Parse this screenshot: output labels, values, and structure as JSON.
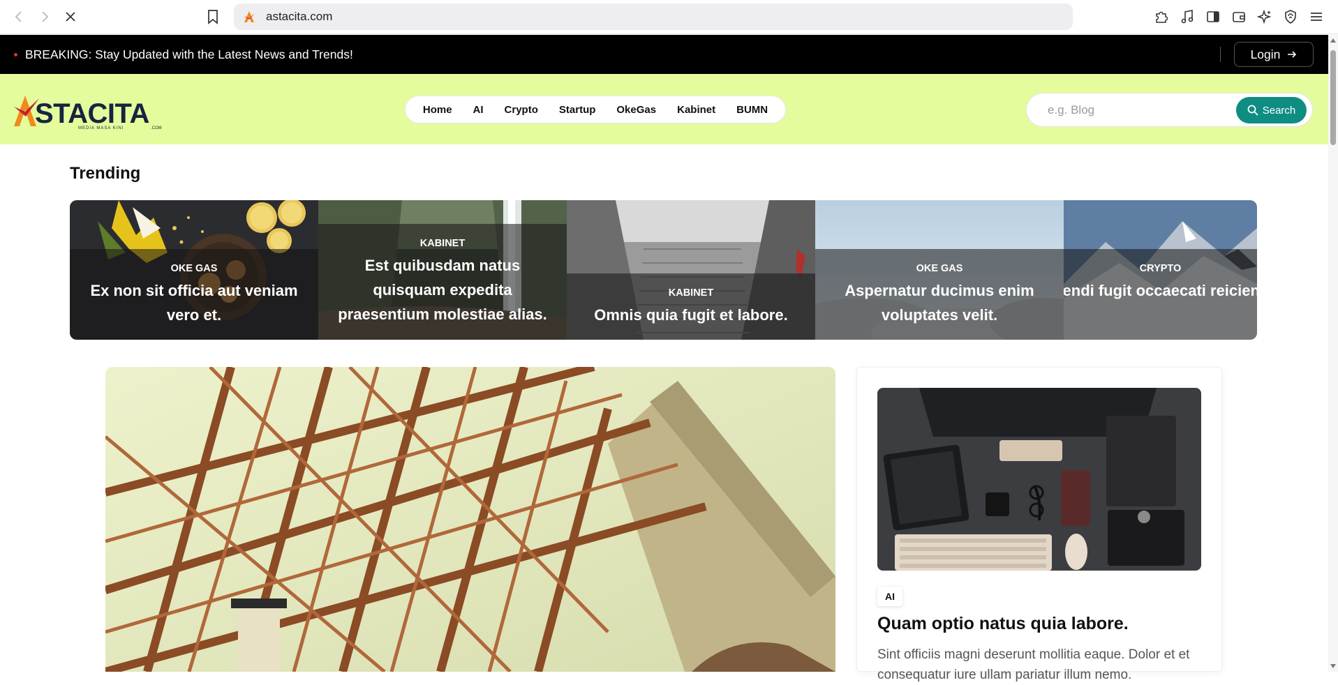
{
  "browser": {
    "url": "astacita.com",
    "icons": [
      "back-icon",
      "forward-icon",
      "stop-loading-icon",
      "bookmark-icon",
      "extensions-icon",
      "music-icon",
      "sidebar-icon",
      "wallet-icon",
      "ai-sparkle-icon",
      "shield-icon",
      "menu-icon"
    ]
  },
  "breaking": {
    "text": "BREAKING: Stay Updated with the Latest News and Trends!",
    "login_label": "Login",
    "dot_color": "#e0312b"
  },
  "header": {
    "logo_alt": "ASTACITA",
    "nav": [
      "Home",
      "AI",
      "Crypto",
      "Startup",
      "OkeGas",
      "Kabinet",
      "BUMN"
    ],
    "search_placeholder": "e.g. Blog",
    "search_label": "Search",
    "accent": "#0f8d82",
    "background": "#e4fc9c"
  },
  "trending": {
    "title": "Trending",
    "items": [
      {
        "category": "OKE GAS",
        "title": "Ex non sit officia aut veniam vero et."
      },
      {
        "category": "KABINET",
        "title": "Est quibusdam natus quisquam expedita praesentium molestiae alias."
      },
      {
        "category": "KABINET",
        "title": "Omnis quia fugit et labore."
      },
      {
        "category": "OKE GAS",
        "title": "Aspernatur ducimus enim voluptates velit."
      },
      {
        "category": "CRYPTO",
        "title": "Amet eligendi fugit occaecati reiciendis iusto."
      }
    ]
  },
  "side_post": {
    "category": "AI",
    "title": "Quam optio natus quia labore.",
    "excerpt": "Sint officiis magni deserunt mollitia eaque. Dolor et et consequatur iure ullam pariatur illum nemo."
  }
}
